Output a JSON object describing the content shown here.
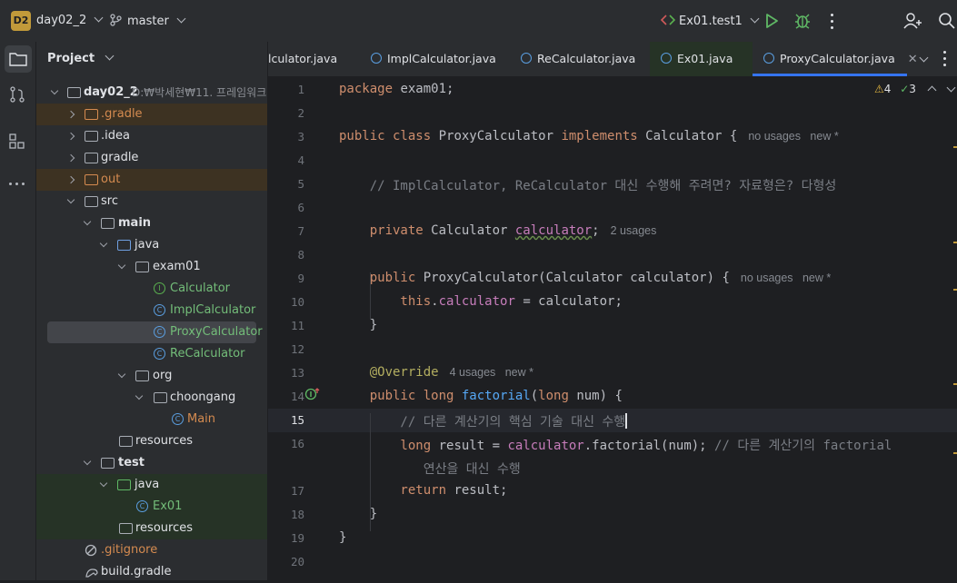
{
  "titlebar": {
    "project_badge": "D2",
    "project_name": "day02_2",
    "branch": "master",
    "run_config": "Ex01.test1"
  },
  "project_panel": {
    "title": "Project",
    "root_name": "day02_2",
    "root_path": "D:₩박세현₩11. 프레임워크",
    "items": [
      {
        "label": ".gradle"
      },
      {
        "label": ".idea"
      },
      {
        "label": "gradle"
      },
      {
        "label": "out"
      },
      {
        "label": "src"
      },
      {
        "label": "main"
      },
      {
        "label": "java"
      },
      {
        "label": "exam01"
      },
      {
        "label": "Calculator"
      },
      {
        "label": "ImplCalculator"
      },
      {
        "label": "ProxyCalculator"
      },
      {
        "label": "ReCalculator"
      },
      {
        "label": "org"
      },
      {
        "label": "choongang"
      },
      {
        "label": "Main"
      },
      {
        "label": "resources"
      },
      {
        "label": "test"
      },
      {
        "label": "java"
      },
      {
        "label": "Ex01"
      },
      {
        "label": "resources"
      },
      {
        "label": ".gitignore"
      },
      {
        "label": "build.gradle"
      }
    ]
  },
  "tabs": [
    {
      "label": "lculator.java"
    },
    {
      "label": "ImplCalculator.java"
    },
    {
      "label": "ReCalculator.java"
    },
    {
      "label": "Ex01.java"
    },
    {
      "label": "ProxyCalculator.java"
    }
  ],
  "inspections": {
    "warnings": "4",
    "ok": "3"
  },
  "line_numbers": [
    "1",
    "2",
    "3",
    "4",
    "5",
    "6",
    "7",
    "8",
    "9",
    "10",
    "11",
    "12",
    "13",
    "14",
    "15",
    "16",
    "",
    "17",
    "18",
    "19",
    "20"
  ],
  "code": {
    "l1_kw": "package",
    "l1_rest": " exam01;",
    "l3_kw1": "public class",
    "l3_name": " ProxyCalculator ",
    "l3_kw2": "implements",
    "l3_rest": " Calculator {",
    "l3_hint": "no usages   new *",
    "l5": "    // ImplCalculator, ReCalculator 대신 수행해 주려면? 자료형은? 다형성",
    "l7_kw": "    private",
    "l7_type": " Calculator ",
    "l7_fld": "calculator",
    "l7_rest": ";",
    "l7_hint": "2 usages",
    "l9_kw": "    public",
    "l9_name": " ProxyCalculator",
    "l9_rest": "(Calculator calculator) {",
    "l9_hint": "no usages   new *",
    "l10_kw": "        this",
    "l10_dot": ".",
    "l10_fld": "calculator",
    "l10_rest": " = calculator;",
    "l11": "    }",
    "l13_ann": "    @Override",
    "l13_hint": "4 usages   new *",
    "l14_kw": "    public long",
    "l14_fn": " factorial",
    "l14_rest1": "(",
    "l14_kw2": "long",
    "l14_rest2": " num) {",
    "l15": "        // 다른 계산기의 핵심 기술 대신 수행",
    "l16_kw": "        long",
    "l16_a": " result = ",
    "l16_fld": "calculator",
    "l16_b": ".factorial(num); ",
    "l16_cm": "// 다른 계산기의 factorial",
    "l16_wrap": "           연산을 대신 수행",
    "l17_kw": "        return",
    "l17_rest": " result;",
    "l18": "    }",
    "l19": "}"
  },
  "colors": {
    "accent": "#3574f0",
    "editor_bg": "#1e1f22",
    "panel_bg": "#2b2d30"
  }
}
